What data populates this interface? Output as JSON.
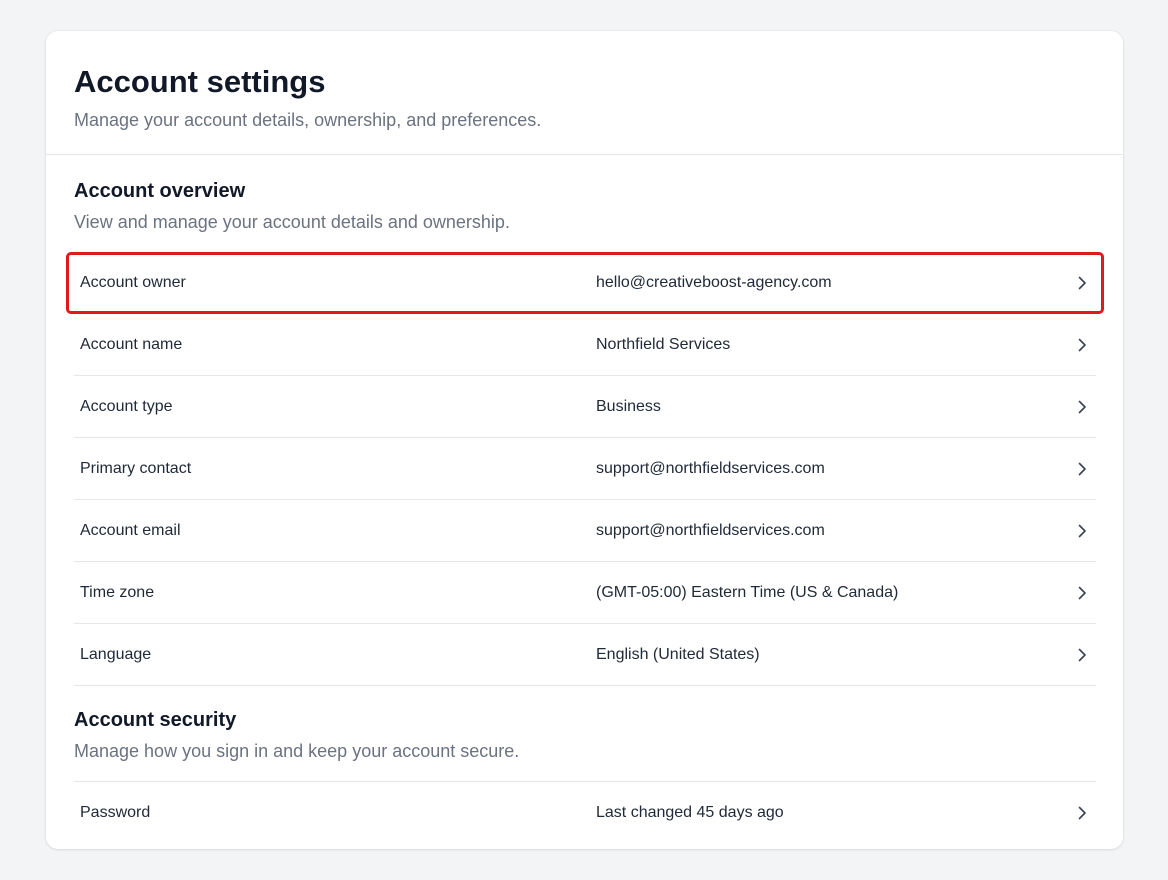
{
  "header": {
    "title": "Account settings",
    "subtitle": "Manage your account details, ownership, and preferences."
  },
  "overview": {
    "title": "Account overview",
    "description": "View and manage your account details and ownership.",
    "rows": [
      {
        "label": "Account owner",
        "value": "hello@creativeboost-agency.com"
      },
      {
        "label": "Account name",
        "value": "Northfield Services"
      },
      {
        "label": "Account type",
        "value": "Business"
      },
      {
        "label": "Primary contact",
        "value": "support@northfieldservices.com"
      },
      {
        "label": "Account email",
        "value": "support@northfieldservices.com"
      },
      {
        "label": "Time zone",
        "value": "(GMT-05:00) Eastern Time (US & Canada)"
      },
      {
        "label": "Language",
        "value": "English (United States)"
      }
    ]
  },
  "security": {
    "title": "Account security",
    "description": "Manage how you sign in and keep your account secure.",
    "rows": [
      {
        "label": "Password",
        "value": "Last changed 45 days ago"
      }
    ]
  },
  "colors": {
    "highlight_border": "#e0191c",
    "text_primary": "#111827",
    "text_secondary": "#6b7280"
  },
  "icons": {
    "row_action": "chevron-right-icon"
  }
}
